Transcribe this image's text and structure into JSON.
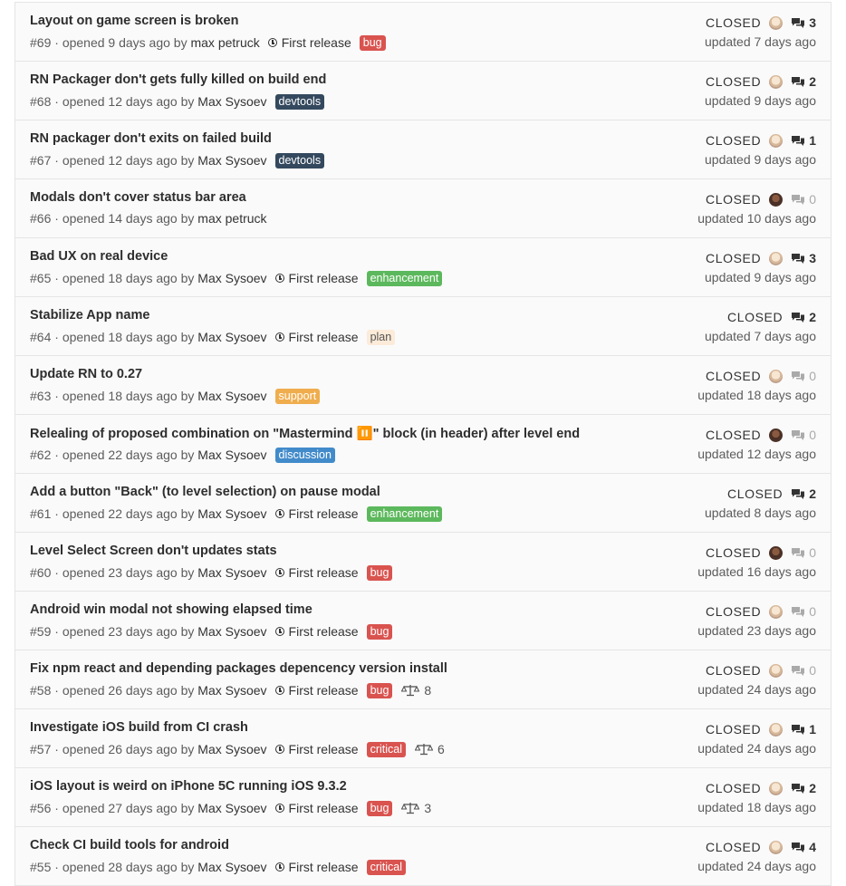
{
  "issues": [
    {
      "title": "Layout on game screen is broken",
      "number": "#69",
      "opened": "opened 9 days ago by",
      "author": "max petruck",
      "milestone": "First release",
      "labels": [
        {
          "text": "bug",
          "bg": "#d9534f",
          "fg": "#ffffff"
        }
      ],
      "weight": "",
      "status": "CLOSED",
      "assignee": "light",
      "comments": "3",
      "updated": "updated 7 days ago"
    },
    {
      "title": "RN Packager don't gets fully killed on build end",
      "number": "#68",
      "opened": "opened 12 days ago by",
      "author": "Max Sysoev",
      "milestone": "",
      "labels": [
        {
          "text": "devtools",
          "bg": "#34495e",
          "fg": "#ffffff"
        }
      ],
      "weight": "",
      "status": "CLOSED",
      "assignee": "light",
      "comments": "2",
      "updated": "updated 9 days ago"
    },
    {
      "title": "RN packager don't exits on failed build",
      "number": "#67",
      "opened": "opened 12 days ago by",
      "author": "Max Sysoev",
      "milestone": "",
      "labels": [
        {
          "text": "devtools",
          "bg": "#34495e",
          "fg": "#ffffff"
        }
      ],
      "weight": "",
      "status": "CLOSED",
      "assignee": "light",
      "comments": "1",
      "updated": "updated 9 days ago"
    },
    {
      "title": "Modals don't cover status bar area",
      "number": "#66",
      "opened": "opened 14 days ago by",
      "author": "max petruck",
      "milestone": "",
      "labels": [],
      "weight": "",
      "status": "CLOSED",
      "assignee": "dark",
      "comments": "0",
      "updated": "updated 10 days ago"
    },
    {
      "title": "Bad UX on real device",
      "number": "#65",
      "opened": "opened 18 days ago by",
      "author": "Max Sysoev",
      "milestone": "First release",
      "labels": [
        {
          "text": "enhancement",
          "bg": "#5cb85c",
          "fg": "#ffffff"
        }
      ],
      "weight": "",
      "status": "CLOSED",
      "assignee": "light",
      "comments": "3",
      "updated": "updated 9 days ago"
    },
    {
      "title": "Stabilize App name",
      "number": "#64",
      "opened": "opened 18 days ago by",
      "author": "Max Sysoev",
      "milestone": "First release",
      "labels": [
        {
          "text": "plan",
          "bg": "#fcebd9",
          "fg": "#555555"
        }
      ],
      "weight": "",
      "status": "CLOSED",
      "assignee": "",
      "comments": "2",
      "updated": "updated 7 days ago"
    },
    {
      "title": "Update RN to 0.27",
      "number": "#63",
      "opened": "opened 18 days ago by",
      "author": "Max Sysoev",
      "milestone": "",
      "labels": [
        {
          "text": "support",
          "bg": "#f0ad4e",
          "fg": "#ffffff"
        }
      ],
      "weight": "",
      "status": "CLOSED",
      "assignee": "light",
      "comments": "0",
      "updated": "updated 18 days ago"
    },
    {
      "title": "Relealing of proposed combination on \"Mastermind ⏸️\" block (in header) after level end",
      "number": "#62",
      "opened": "opened 22 days ago by",
      "author": "Max Sysoev",
      "milestone": "",
      "labels": [
        {
          "text": "discussion",
          "bg": "#428bca",
          "fg": "#ffffff"
        }
      ],
      "weight": "",
      "status": "CLOSED",
      "assignee": "dark",
      "comments": "0",
      "updated": "updated 12 days ago"
    },
    {
      "title": "Add a button \"Back\" (to level selection) on pause modal",
      "number": "#61",
      "opened": "opened 22 days ago by",
      "author": "Max Sysoev",
      "milestone": "First release",
      "labels": [
        {
          "text": "enhancement",
          "bg": "#5cb85c",
          "fg": "#ffffff"
        }
      ],
      "weight": "",
      "status": "CLOSED",
      "assignee": "",
      "comments": "2",
      "updated": "updated 8 days ago"
    },
    {
      "title": "Level Select Screen don't updates stats",
      "number": "#60",
      "opened": "opened 23 days ago by",
      "author": "Max Sysoev",
      "milestone": "First release",
      "labels": [
        {
          "text": "bug",
          "bg": "#d9534f",
          "fg": "#ffffff"
        }
      ],
      "weight": "",
      "status": "CLOSED",
      "assignee": "dark",
      "comments": "0",
      "updated": "updated 16 days ago"
    },
    {
      "title": "Android win modal not showing elapsed time",
      "number": "#59",
      "opened": "opened 23 days ago by",
      "author": "Max Sysoev",
      "milestone": "First release",
      "labels": [
        {
          "text": "bug",
          "bg": "#d9534f",
          "fg": "#ffffff"
        }
      ],
      "weight": "",
      "status": "CLOSED",
      "assignee": "light",
      "comments": "0",
      "updated": "updated 23 days ago"
    },
    {
      "title": "Fix npm react and depending packages depencency version install",
      "number": "#58",
      "opened": "opened 26 days ago by",
      "author": "Max Sysoev",
      "milestone": "First release",
      "labels": [
        {
          "text": "bug",
          "bg": "#d9534f",
          "fg": "#ffffff"
        }
      ],
      "weight": "8",
      "status": "CLOSED",
      "assignee": "light",
      "comments": "0",
      "updated": "updated 24 days ago"
    },
    {
      "title": "Investigate iOS build from CI crash",
      "number": "#57",
      "opened": "opened 26 days ago by",
      "author": "Max Sysoev",
      "milestone": "First release",
      "labels": [
        {
          "text": "critical",
          "bg": "#d9534f",
          "fg": "#ffffff"
        }
      ],
      "weight": "6",
      "status": "CLOSED",
      "assignee": "light",
      "comments": "1",
      "updated": "updated 24 days ago"
    },
    {
      "title": "iOS layout is weird on iPhone 5C running iOS 9.3.2",
      "number": "#56",
      "opened": "opened 27 days ago by",
      "author": "Max Sysoev",
      "milestone": "First release",
      "labels": [
        {
          "text": "bug",
          "bg": "#d9534f",
          "fg": "#ffffff"
        }
      ],
      "weight": "3",
      "status": "CLOSED",
      "assignee": "light",
      "comments": "2",
      "updated": "updated 18 days ago"
    },
    {
      "title": "Check CI build tools for android",
      "number": "#55",
      "opened": "opened 28 days ago by",
      "author": "Max Sysoev",
      "milestone": "First release",
      "labels": [
        {
          "text": "critical",
          "bg": "#d9534f",
          "fg": "#ffffff"
        }
      ],
      "weight": "",
      "status": "CLOSED",
      "assignee": "light",
      "comments": "4",
      "updated": "updated 24 days ago"
    }
  ]
}
